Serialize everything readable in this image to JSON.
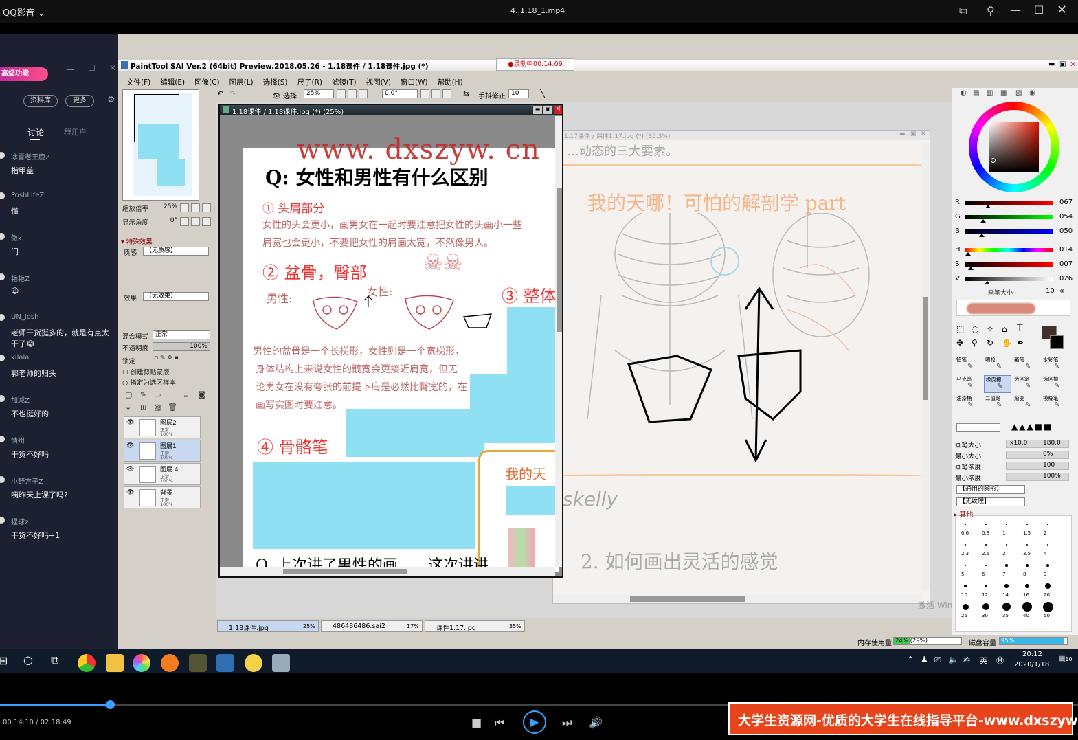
{
  "player": {
    "app_name": "QQ影音",
    "file_name": "4..1.18_1.mp4",
    "time_current": "00:14:10",
    "time_total": "02:18:49",
    "progress": 0.102,
    "sep": " / "
  },
  "banner": {
    "text": "大学生资源网-优质的大学生在线指导平台-www.dxszyw.cn"
  },
  "watermark": "www. dxszyw. cn",
  "chat": {
    "badge": "高级功能",
    "btn_library": "资料库",
    "btn_more": "更多",
    "tab_discuss": "讨论",
    "tab_members": "群用户",
    "messages": [
      {
        "name": "冰雪老王鹿Z",
        "text": "指甲盖"
      },
      {
        "name": "PoshLifeZ",
        "text": "懂"
      },
      {
        "name": "傲k",
        "text": "门"
      },
      {
        "name": "艳艳Z",
        "text": "😩"
      },
      {
        "name": "UN_Josh",
        "text": "老师干货挺多的，就是有点太干了😂"
      },
      {
        "name": "kilala",
        "text": "郭老师的归头"
      },
      {
        "name": "加减Z",
        "text": "不也挺好的"
      },
      {
        "name": "情州",
        "text": "干货不好吗"
      },
      {
        "name": "小野方子Z",
        "text": "咦昨天上课了吗?"
      },
      {
        "name": "猩球z",
        "text": "干货不好吗+1"
      }
    ]
  },
  "sai": {
    "title": "PaintTool SAI Ver.2 (64bit) Preview.2018.05.26 - 1.18课件 / 1.18课件.jpg (*)",
    "recording": "●录制中00:14:09",
    "menu": [
      "文件(F)",
      "编辑(E)",
      "图像(C)",
      "图层(L)",
      "选择(S)",
      "尺子(R)",
      "滤镜(T)",
      "视图(V)",
      "窗口(W)",
      "帮助(H)"
    ],
    "toolbar": {
      "select_label": "选择",
      "zoom": "25%",
      "angle": "0.0°",
      "stabilizer_label": "手抖修正",
      "stabilizer": "10"
    },
    "left": {
      "zoom_label": "缩放倍率",
      "zoom_value": "25%",
      "angle_label": "显示角度",
      "angle_value": "0°",
      "effects_label": "▾ 特殊效果",
      "texture_label": "质感",
      "texture_value": "【无质感】",
      "effect_label": "效果",
      "effect_value": "【无效果】",
      "blend_label": "混合模式",
      "blend_value": "正常",
      "opacity_label": "不透明度",
      "opacity_value": "100%",
      "lock_label": "锁定",
      "clip_label": "创建剪贴蒙版",
      "sel_src_label": "指定为选区样本",
      "layers": [
        {
          "name": "图层2",
          "mode": "正常",
          "opacity": "100%"
        },
        {
          "name": "图层1",
          "mode": "正常",
          "opacity": "100%"
        },
        {
          "name": "图层 4",
          "mode": "正常",
          "opacity": "100%"
        },
        {
          "name": "背景",
          "mode": "正常",
          "opacity": "100%"
        }
      ]
    },
    "doc1": {
      "title": "1.18课件 / 1.18课件.jpg (*) (25%)",
      "q": "Q: 女性和男性有什么区别",
      "s1": "① 头肩部分",
      "t1a": "女性的头会更小，画男女在一起时要注意把女性的头画小一些",
      "t1b": "肩宽也会更小，不要把女性的肩画太宽，不然像男人。",
      "s2": "② 盆骨，臀部",
      "male": "男性:",
      "female": "女性:",
      "s3": "③ 整体",
      "t2a": "男性的盆骨是一个长梯形，女性则是一个宽梯形，",
      "t2b": "身体结构上来说女性的髋宽会更接近肩宽，但无",
      "t2c": "论男女在没有夸张的前提下肩是必然比臀宽的，在",
      "t2d": "画写实图时要注意。",
      "s4": "④ 骨骼笔",
      "bottom": "Q. 上次讲了男性的画……这次讲讲",
      "preview": "我的天"
    },
    "doc2": {
      "title": "1.17课件 / 课件1.17.jpg (*) (35.3%)",
      "top": "…动态的三大要素。",
      "heading": "我的天哪！可怕的解剖学 part",
      "sig": "skelly",
      "bottom": "2. 如何画出灵活的感觉"
    },
    "tabs": [
      {
        "name": "1.18课件.jpg",
        "zoom": "25%"
      },
      {
        "name": "486486486.sai2",
        "zoom": "17%"
      },
      {
        "name": "课件1.17.jpg",
        "zoom": "35%"
      }
    ],
    "color": {
      "current": "#433028",
      "r_label": "R",
      "r": "067",
      "g_label": "G",
      "g": "054",
      "b_label": "B",
      "b": "050",
      "h_label": "H",
      "h": "014",
      "s_label": "S",
      "s": "007",
      "v_label": "V",
      "v": "026",
      "r_frac": 0.263,
      "g_frac": 0.212,
      "b_frac": 0.196,
      "h_frac": 0.039,
      "s_frac": 0.07,
      "v_frac": 0.26
    },
    "brush_size_label": "画笔大小",
    "brush_size_value": "10",
    "tools": [
      "铅笔",
      "喷枪",
      "画笔",
      "水彩笔",
      "马克笔",
      "橡皮擦",
      "选区笔",
      "选区擦",
      "油漆桶",
      "二值笔",
      "渐变",
      "模糊笔"
    ],
    "brush": {
      "size_label": "画笔大小",
      "size_mult": "x10.0",
      "size": "180.0",
      "min_size_label": "最小大小",
      "min_size": "0%",
      "density_label": "画笔浓度",
      "density": "100",
      "min_density_label": "最小浓度",
      "min_density": "100%",
      "shape": "【通用的圆形】",
      "texture": "【无纹理】",
      "other": "▸ 其他",
      "preset_sizes": [
        "0.6",
        "0.8",
        "1",
        "1.5",
        "2",
        "2.3",
        "2.6",
        "3",
        "3.5",
        "4",
        "5",
        "6",
        "7",
        "8",
        "9",
        "10",
        "12",
        "14",
        "16",
        "20",
        "25",
        "30",
        "35",
        "40",
        "50"
      ]
    },
    "status": {
      "mem_label": "内存使用量",
      "mem": "24% (29%)",
      "mem_frac": 0.24,
      "disk_label": "磁盘容量",
      "disk": "95%",
      "disk_frac": 0.95
    },
    "activate": "激活 Windows"
  },
  "taskbar": {
    "ime": "英",
    "time": "20:12",
    "date": "2020/1/18",
    "notif": "10"
  }
}
